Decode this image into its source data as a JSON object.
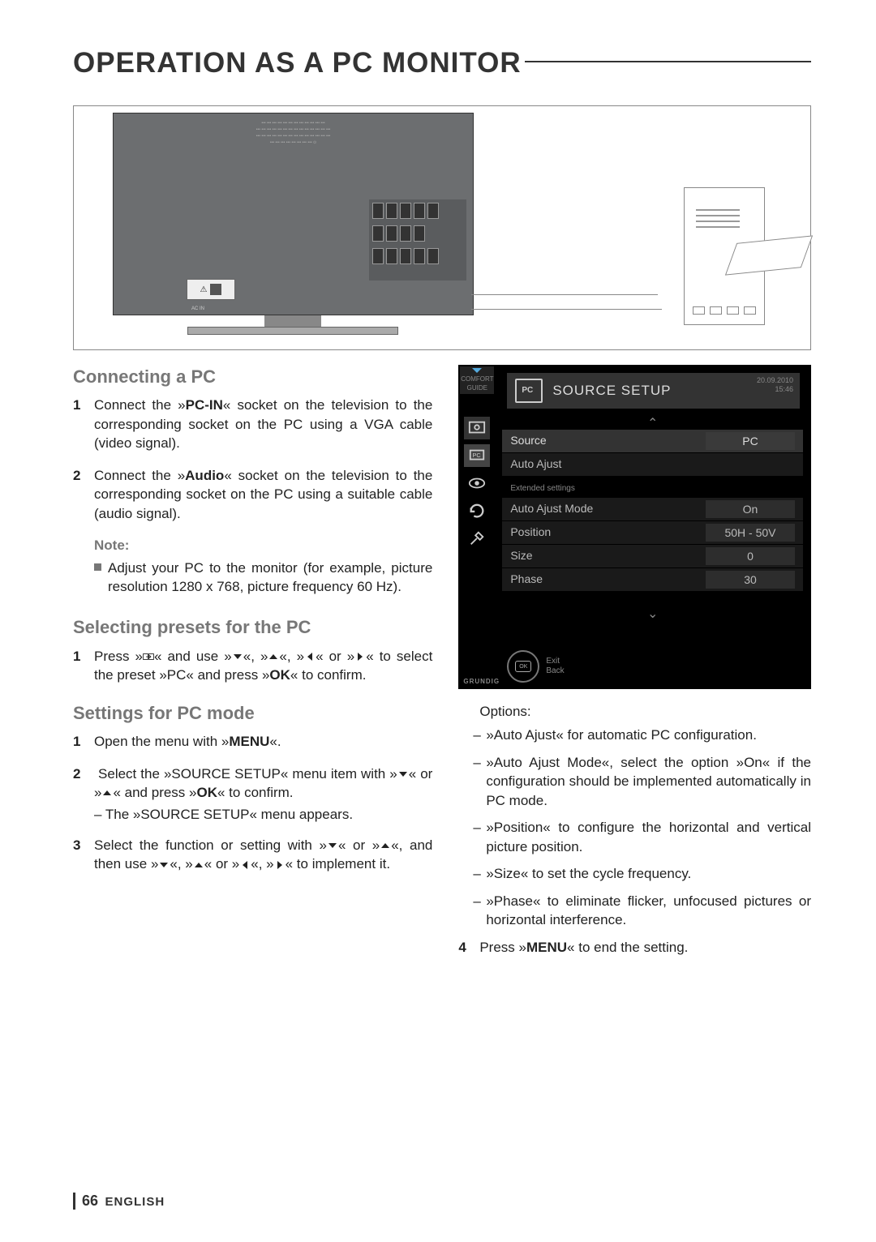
{
  "title": "OPERATION AS A PC MONITOR",
  "connecting": {
    "heading": "Connecting a PC",
    "step1_a": "Connect the »",
    "step1_b": "PC-IN",
    "step1_c": "« socket on the television to the corresponding socket on the PC using a VGA cable (video signal).",
    "step2_a": "Connect the »",
    "step2_b": "Audio",
    "step2_c": "« socket on the television to the corresponding socket on the PC using a suitable cable (audio signal).",
    "note_h": "Note:",
    "note_body": "Adjust your PC to the monitor (for example, picture resolution 1280 x 768, picture frequency 60 Hz)."
  },
  "presets": {
    "heading": "Selecting presets for the PC",
    "step1_a": "Press »",
    "step1_b": "« and use »",
    "step1_c": "«, »",
    "step1_d": "«, »",
    "step1_e": "« or »",
    "step1_f": "« to select the preset »PC« and press »",
    "step1_g": "OK",
    "step1_h": "« to confirm."
  },
  "settings": {
    "heading": "Settings for PC mode",
    "s1_a": "Open the menu with »",
    "s1_b": "MENU",
    "s1_c": "«.",
    "s2_a": "Select the »SOURCE SETUP« menu item with »",
    "s2_b": "« or »",
    "s2_c": "« and press »",
    "s2_d": "OK",
    "s2_e": "« to confirm.",
    "s2_sub": "– The »SOURCE SETUP« menu appears.",
    "s3_a": "Select the function or setting with »",
    "s3_b": "« or »",
    "s3_c": "«, and then use »",
    "s3_d": "«, »",
    "s3_e": "« or »",
    "s3_f": "«, »",
    "s3_g": "« to implement it."
  },
  "osd": {
    "comfort": "COMFORT GUIDE",
    "title": "SOURCE SETUP",
    "date": "20.09.2010",
    "time": "15:46",
    "source_k": "Source",
    "source_v": "PC",
    "autoajust": "Auto Ajust",
    "ext": "Extended settings",
    "aam_k": "Auto Ajust Mode",
    "aam_v": "On",
    "pos_k": "Position",
    "pos_v": "50H - 50V",
    "size_k": "Size",
    "size_v": "0",
    "phase_k": "Phase",
    "phase_v": "30",
    "ok": "OK",
    "exit": "Exit",
    "back": "Back",
    "brand": "GRUNDIG"
  },
  "options": {
    "heading": "Options:",
    "o1": "»Auto Ajust« for automatic PC configuration.",
    "o2": "»Auto Ajust Mode«, select the option »On« if the configuration should be implemented automatically in PC mode.",
    "o3": "»Position« to configure the horizontal and vertical picture position.",
    "o4": "»Size« to set the cycle frequency.",
    "o5": "»Phase« to eliminate flicker, unfocused pictures or horizontal interference.",
    "s4_a": "Press »",
    "s4_b": "MENU",
    "s4_c": "« to end the setting."
  },
  "footer": {
    "page": "66",
    "lang": "ENGLISH"
  },
  "illus": {
    "ac": "AC IN"
  }
}
